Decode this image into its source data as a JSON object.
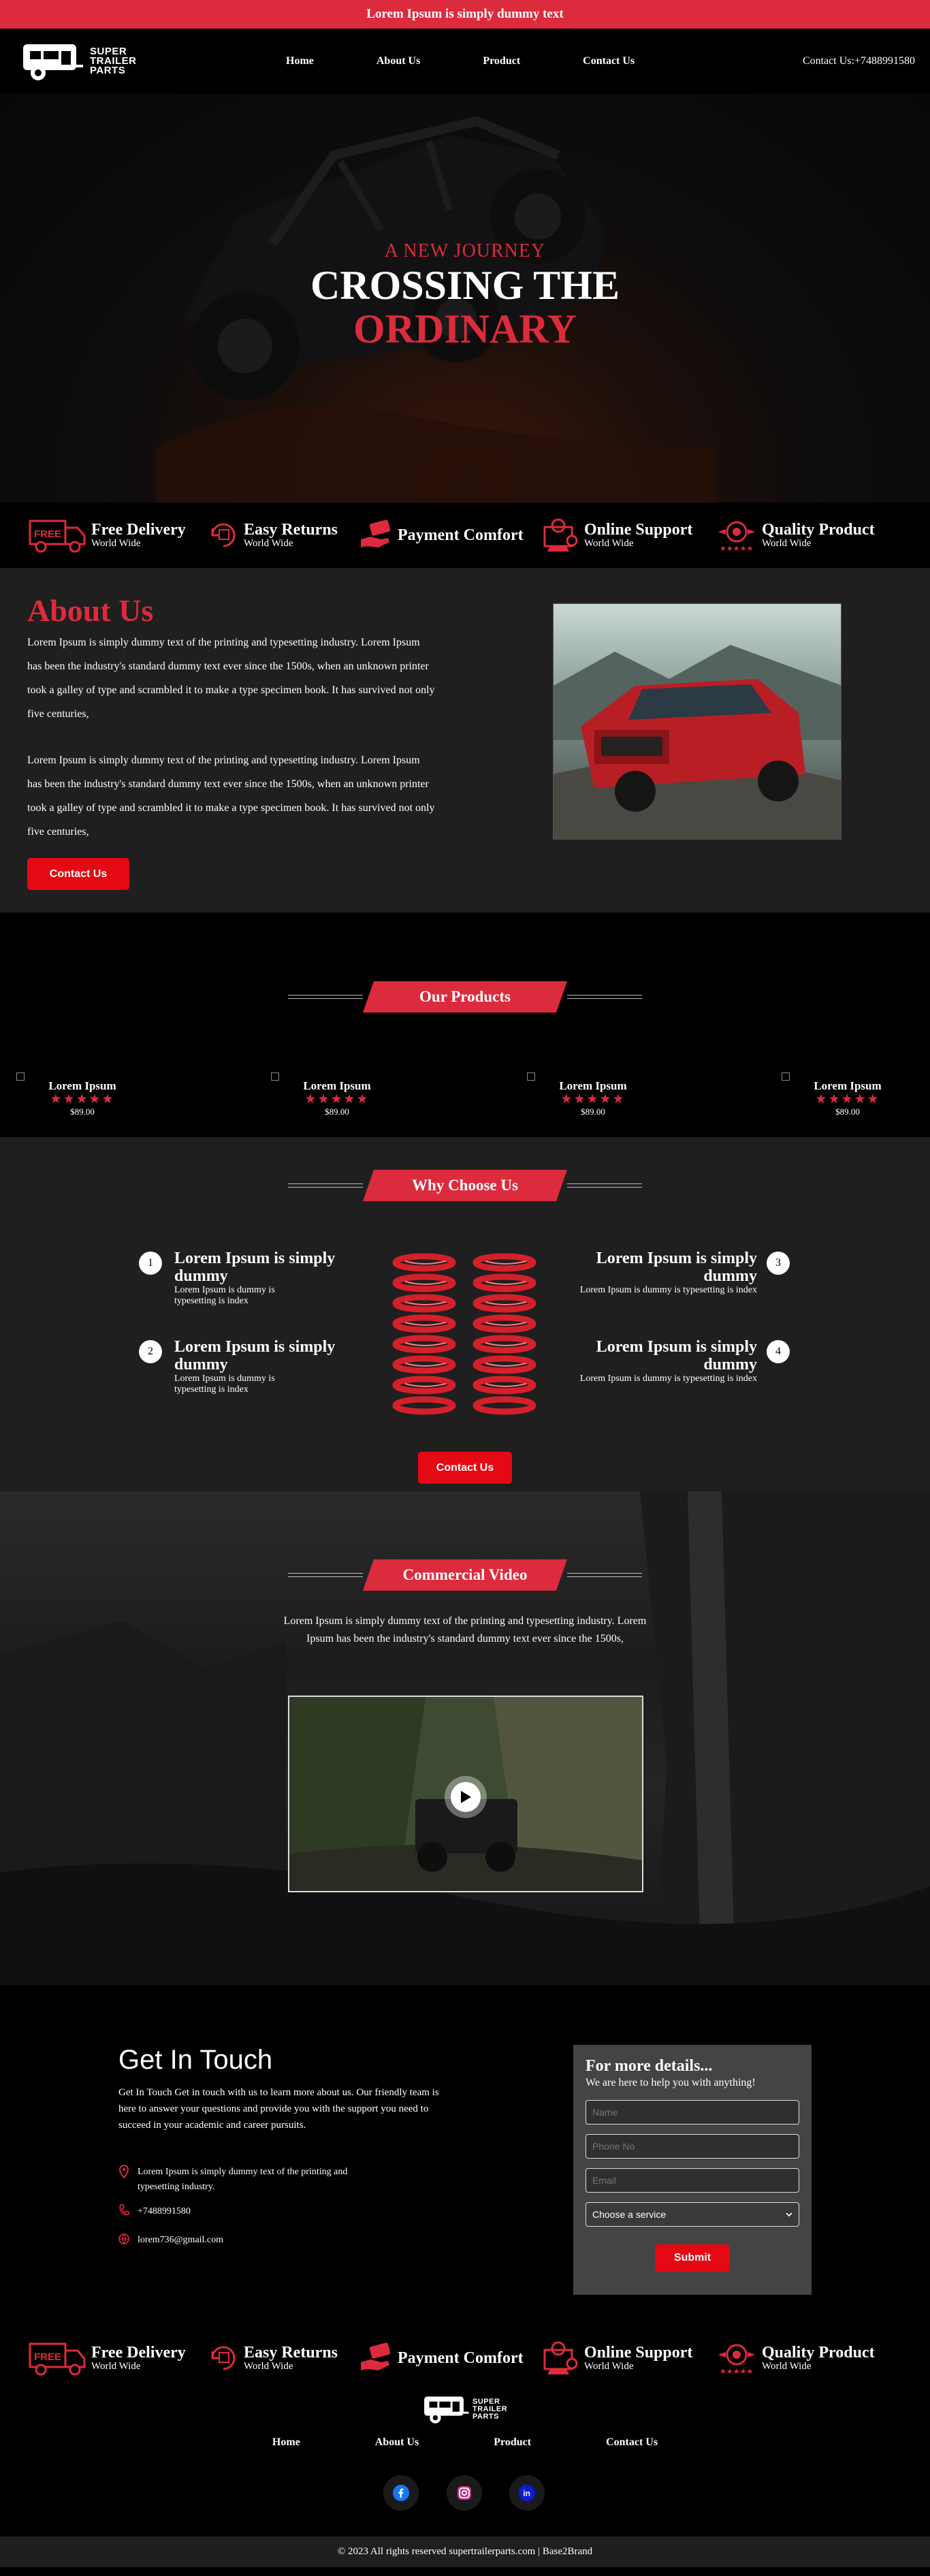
{
  "topbar": {
    "text": "Lorem Ipsum is simply dummy text"
  },
  "brand": {
    "line1": "SUPER",
    "line2": "TRAILER",
    "line3": "PARTS"
  },
  "nav": {
    "items": [
      "Home",
      "About Us",
      "Product",
      "Contact Us"
    ]
  },
  "header": {
    "contact": "Contact Us:+7488991580"
  },
  "hero": {
    "subtitle": "A NEW JOURNEY",
    "title_line1": "CROSSING THE",
    "title_line2": "ORDINARY"
  },
  "features": [
    {
      "icon": "truck-icon",
      "badge": "FREE",
      "title": "Free Delivery",
      "sub": "World Wide"
    },
    {
      "icon": "returns-icon",
      "title": "Easy Returns",
      "sub": "World Wide"
    },
    {
      "icon": "payment-hand-icon",
      "title": "Payment Comfort",
      "sub": ""
    },
    {
      "icon": "support-icon",
      "title": "Online Support",
      "sub": "World Wide"
    },
    {
      "icon": "quality-icon",
      "title": "Quality Product",
      "sub": "World Wide"
    }
  ],
  "about": {
    "heading": "About Us",
    "para1": "Lorem Ipsum is simply dummy text of the printing and typesetting industry. Lorem Ipsum has been the industry's standard dummy text ever since the 1500s, when an unknown printer took a galley of type and scrambled it to make a type specimen book. It has survived not only five centuries,",
    "para2": "Lorem Ipsum is simply dummy text of the printing and typesetting industry. Lorem Ipsum has been the industry's standard dummy text ever since the 1500s, when an unknown printer took a galley of type and scrambled it to make a type specimen book. It has survived not only five centuries,",
    "button": "Contact Us"
  },
  "products": {
    "heading": "Our Products",
    "items": [
      {
        "name": "Lorem Ipsum",
        "stars": "★★★★★",
        "price": "$89.00"
      },
      {
        "name": "Lorem Ipsum",
        "stars": "★★★★★",
        "price": "$89.00"
      },
      {
        "name": "Lorem Ipsum",
        "stars": "★★★★★",
        "price": "$89.00"
      },
      {
        "name": "Lorem Ipsum",
        "stars": "★★★★★",
        "price": "$89.00"
      }
    ]
  },
  "why": {
    "heading": "Why Choose Us",
    "items": [
      {
        "num": "1",
        "title": "Lorem Ipsum is simply dummy",
        "desc": "Lorem Ipsum is dummy is typesetting is index"
      },
      {
        "num": "2",
        "title": "Lorem Ipsum is simply dummy",
        "desc": "Lorem Ipsum is dummy is typesetting is index"
      },
      {
        "num": "3",
        "title": "Lorem Ipsum is simply dummy",
        "desc": "Lorem Ipsum is dummy is typesetting is index"
      },
      {
        "num": "4",
        "title": "Lorem Ipsum is simply dummy",
        "desc": "Lorem Ipsum is dummy is typesetting is index"
      }
    ],
    "button": "Contact Us"
  },
  "video": {
    "heading": "Commercial Video",
    "text": "Lorem Ipsum is simply dummy text of the printing and typesetting industry. Lorem Ipsum has been the industry's standard dummy text ever since the 1500s,"
  },
  "contact": {
    "heading": "Get In Touch",
    "text": "Get In Touch Get in touch with us to learn more about us. Our friendly team is here to answer your questions and provide you with the support you need to succeed in your academic and career pursuits.",
    "address": "Lorem Ipsum is simply dummy text of the printing and typesetting industry.",
    "phone": "+7488991580",
    "email": "lorem736@gmail.com"
  },
  "form": {
    "heading": "For more details...",
    "sub": "We are here to help you with anything!",
    "name_placeholder": "Name",
    "phone_placeholder": "Phone No",
    "email_placeholder": "Email",
    "service_selected": "Choose a service",
    "submit": "Submit"
  },
  "footer": {
    "nav": [
      "Home",
      "About Us",
      "Product",
      "Contact Us"
    ],
    "copyright": "© 2023 All rights reserved supertrailerparts.com | Base2Brand"
  },
  "colors": {
    "accent": "#dc2b3d",
    "button": "#e50914",
    "panel": "#1f1f1f",
    "form": "#444444"
  }
}
